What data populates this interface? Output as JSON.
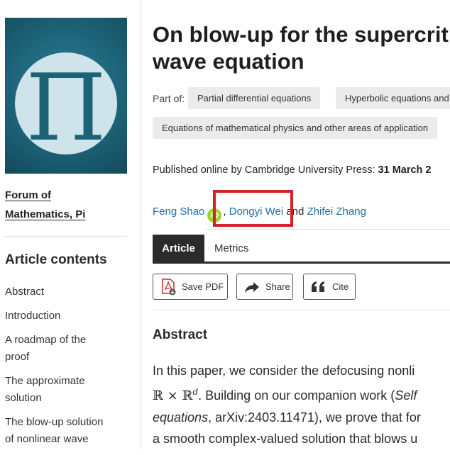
{
  "sidebar": {
    "cover_glyph": "Π",
    "journal_link_line1": "Forum of",
    "journal_link_line2": "Mathematics, Pi",
    "contents_title": "Article contents",
    "contents": [
      {
        "line1": "Abstract",
        "line2": ""
      },
      {
        "line1": "Introduction",
        "line2": ""
      },
      {
        "line1": "A roadmap of the",
        "line2": "proof"
      },
      {
        "line1": "The approximate",
        "line2": "solution"
      },
      {
        "line1": "The blow-up solution",
        "line2": "of nonlinear wave"
      }
    ]
  },
  "article": {
    "title_line1": "On blow-up for the supercrit",
    "title_line2": "wave equation",
    "part_of_label": "Part of:",
    "subjects": [
      "Partial differential equations",
      "Hyperbolic equations and",
      "Equations of mathematical physics and other areas of application"
    ],
    "published_prefix": "Published online by Cambridge University Press:",
    "published_date": "31 March 2",
    "authors": {
      "author1": "Feng Shao",
      "orcid_glyph": "iD",
      "sep1": ",",
      "author2": "Dongyi Wei",
      "conj": "and",
      "author3": "Zhifei Zhang"
    },
    "highlight_color": "#d4222a",
    "tabs": {
      "active": "Article",
      "other": "Metrics"
    },
    "toolbar": {
      "save_pdf": "Save PDF",
      "share": "Share",
      "cite": "Cite"
    },
    "abstract_heading": "Abstract",
    "abstract": {
      "line1": "In this paper, we consider the defocusing nonli",
      "line2_math_r": "ℝ × ℝ",
      "line2_math_sup": "d",
      "line2_text": ". Building on our companion work (",
      "line2_ital": "Self",
      "line3_ital": "equations",
      "line3_text": ", arXiv:2403.11471), we prove that for",
      "line4": "a smooth complex-valued solution that blows u"
    }
  }
}
